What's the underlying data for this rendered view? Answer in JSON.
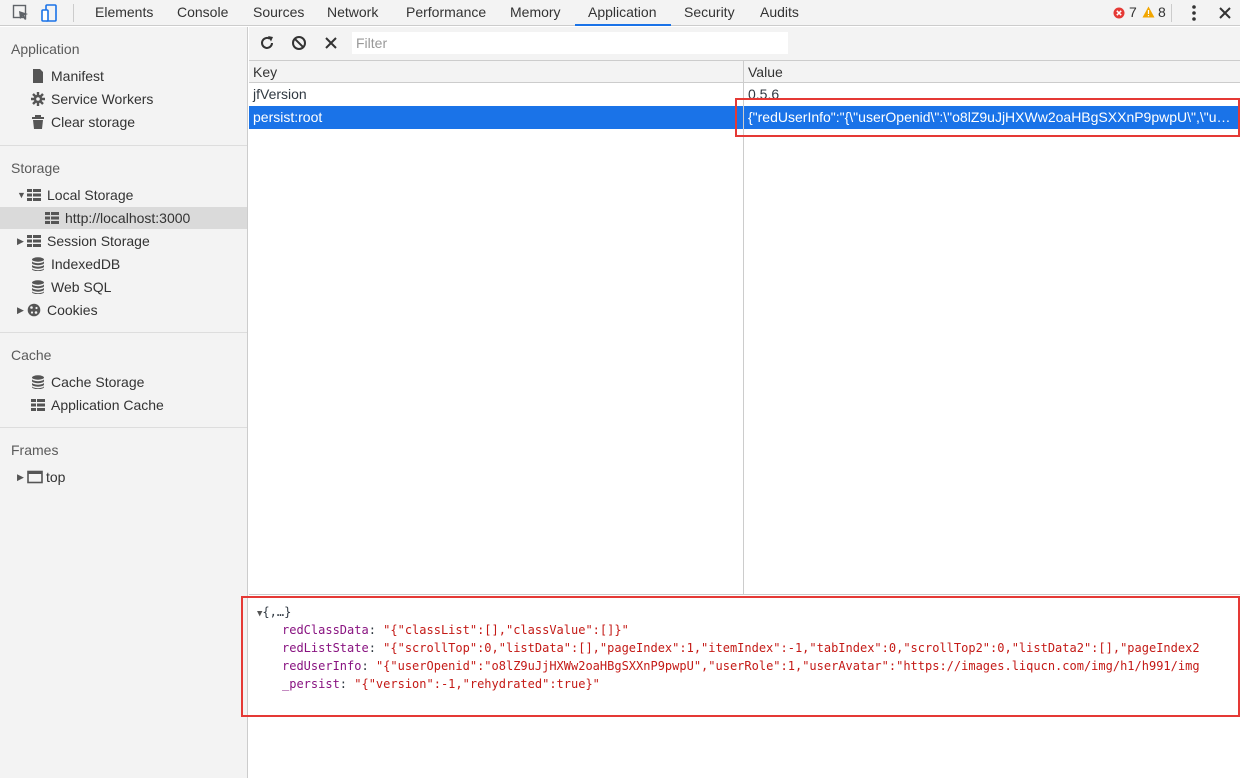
{
  "toolbar_tabs": [
    "Elements",
    "Console",
    "Sources",
    "Network",
    "Performance",
    "Memory",
    "Application",
    "Security",
    "Audits"
  ],
  "active_tab": "Application",
  "errors_count": "7",
  "warnings_count": "8",
  "colors": {
    "accent": "#1a73e8",
    "error": "#e53935",
    "warning": "#f2a600",
    "highlight_box": "#e53935"
  },
  "sidebar": {
    "application": {
      "title": "Application",
      "items": [
        "Manifest",
        "Service Workers",
        "Clear storage"
      ]
    },
    "storage": {
      "title": "Storage",
      "local_storage": "Local Storage",
      "local_origin": "http://localhost:3000",
      "session_storage": "Session Storage",
      "indexeddb": "IndexedDB",
      "websql": "Web SQL",
      "cookies": "Cookies"
    },
    "cache": {
      "title": "Cache",
      "items": [
        "Cache Storage",
        "Application Cache"
      ]
    },
    "frames": {
      "title": "Frames",
      "top": "top"
    }
  },
  "filter": {
    "placeholder": "Filter",
    "value": ""
  },
  "table": {
    "columns": [
      "Key",
      "Value"
    ],
    "rows": [
      {
        "key": "jfVersion",
        "value": "0.5.6"
      },
      {
        "key": "persist:root",
        "value": "{\"redUserInfo\":\"{\\\"userOpenid\\\":\\\"o8lZ9uJjHXWw2oaHBgSXXnP9pwpU\\\",\\\"us..."
      }
    ],
    "selected_row": 1
  },
  "detail": {
    "summary": "{,…}",
    "props": [
      {
        "key": "redClassData",
        "value": "\"{\"classList\":[],\"classValue\":[]}\""
      },
      {
        "key": "redListState",
        "value": "\"{\"scrollTop\":0,\"listData\":[],\"pageIndex\":1,\"itemIndex\":-1,\"tabIndex\":0,\"scrollTop2\":0,\"listData2\":[],\"pageIndex2"
      },
      {
        "key": "redUserInfo",
        "value": "\"{\"userOpenid\":\"o8lZ9uJjHXWw2oaHBgSXXnP9pwpU\",\"userRole\":1,\"userAvatar\":\"https://images.liqucn.com/img/h1/h991/img"
      },
      {
        "key": "_persist",
        "value": "\"{\"version\":-1,\"rehydrated\":true}\""
      }
    ]
  }
}
